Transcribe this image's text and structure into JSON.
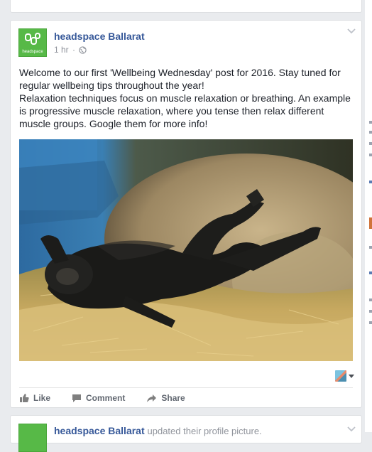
{
  "post": {
    "author": "headspace Ballarat",
    "logo_text": "headspace",
    "timestamp": "1 hr",
    "separator": "·",
    "privacy_icon": "globe-icon",
    "text_lines": [
      "Welcome to our first 'Wellbeing Wednesday' post for 2016. Stay tuned for regular wellbeing tips throughout the year!",
      "Relaxation techniques focus on muscle relaxation or breathing. An example is progressive muscle relaxation, where you tense then relax different muscle groups. Google them for more info!"
    ],
    "photo_icon": "gorilla-photo",
    "menu_icon": "chevron-down-icon"
  },
  "actions": {
    "like": "Like",
    "comment": "Comment",
    "share": "Share"
  },
  "next_post": {
    "author": "headspace Ballarat",
    "suffix": "updated their profile picture."
  },
  "colors": {
    "brand_green": "#57b947",
    "link_blue": "#365899",
    "background": "#e9ebee"
  }
}
